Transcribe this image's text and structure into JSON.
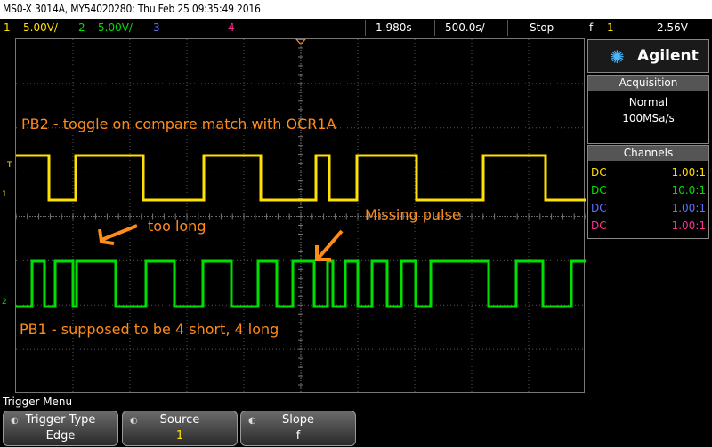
{
  "title": "MS0-X 3014A, MY54020280: Thu Feb 25 09:35:49 2016",
  "status": {
    "ch1": {
      "num": "1",
      "scale": "5.00V/",
      "color": "#ffe000"
    },
    "ch2": {
      "num": "2",
      "scale": "5.00V/",
      "color": "#00e000"
    },
    "ch3": {
      "num": "3",
      "color": "#6070ff"
    },
    "ch4": {
      "num": "4",
      "color": "#ff3090"
    },
    "delay": "1.980s",
    "timebase": "500.0s/",
    "run_state": "Stop",
    "trig_slope": "f",
    "trig_ch": "1",
    "trig_level": "2.56V"
  },
  "annotations": {
    "pb2": "PB2 - toggle on compare match with OCR1A",
    "too_long": "too long",
    "missing": "Missing pulse",
    "pb1": "PB1 - supposed to be 4 short, 4 long"
  },
  "markers": {
    "t": "T",
    "ch1": "1",
    "ch2": "2"
  },
  "brand": "Agilent",
  "acquisition": {
    "header": "Acquisition",
    "mode": "Normal",
    "rate": "100MSa/s"
  },
  "channels": {
    "header": "Channels",
    "rows": [
      {
        "coupling": "DC",
        "ratio": "1.00:1",
        "color": "#ffe000"
      },
      {
        "coupling": "DC",
        "ratio": "10.0:1",
        "color": "#00e000"
      },
      {
        "coupling": "DC",
        "ratio": "1.00:1",
        "color": "#6070ff"
      },
      {
        "coupling": "DC",
        "ratio": "1.00:1",
        "color": "#ff3090"
      }
    ]
  },
  "menu": {
    "title": "Trigger Menu",
    "softkeys": [
      {
        "label": "Trigger Type",
        "value": "Edge"
      },
      {
        "label": "Source",
        "value": "1"
      },
      {
        "label": "Slope",
        "value": "f"
      }
    ]
  },
  "chart_data": {
    "type": "line",
    "series": [
      {
        "name": "PB2",
        "color": "#ffe000",
        "x": [
          0,
          37,
          37,
          67,
          67,
          143,
          143,
          211,
          211,
          275,
          275,
          337,
          337,
          352,
          352,
          383,
          383,
          450,
          450,
          525,
          525,
          595,
          595,
          640
        ],
        "y": [
          1,
          1,
          0,
          0,
          1,
          1,
          0,
          0,
          1,
          1,
          0,
          0,
          1,
          1,
          0,
          0,
          1,
          1,
          0,
          0,
          1,
          1,
          0,
          0
        ]
      },
      {
        "name": "PB1",
        "color": "#00e000",
        "x": [
          0,
          18,
          18,
          32,
          32,
          44,
          44,
          64,
          64,
          68,
          68,
          112,
          112,
          146,
          146,
          178,
          178,
          210,
          210,
          242,
          242,
          272,
          272,
          293,
          293,
          311,
          311,
          335,
          335,
          350,
          350,
          356,
          356,
          370,
          370,
          384,
          384,
          400,
          400,
          417,
          417,
          433,
          433,
          449,
          449,
          466,
          466,
          531,
          531,
          562,
          562,
          592,
          592,
          624,
          624,
          640
        ],
        "y": [
          0,
          0,
          1,
          1,
          0,
          0,
          1,
          1,
          0,
          0,
          1,
          1,
          0,
          0,
          1,
          1,
          0,
          0,
          1,
          1,
          0,
          0,
          1,
          1,
          0,
          0,
          1,
          1,
          0,
          0,
          1,
          1,
          0,
          0,
          1,
          1,
          0,
          0,
          1,
          1,
          0,
          0,
          1,
          1,
          0,
          0,
          1,
          1,
          0,
          0,
          1,
          1,
          0,
          0,
          1,
          1
        ]
      }
    ],
    "grid": true
  }
}
